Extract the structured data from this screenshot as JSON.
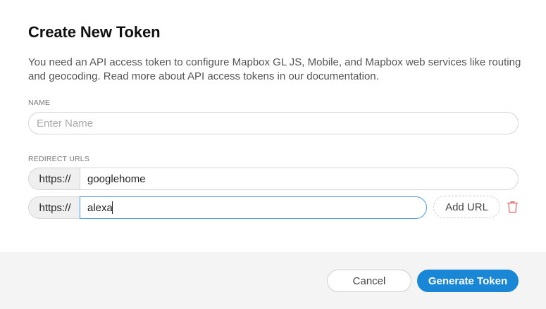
{
  "dialog": {
    "title": "Create New Token",
    "description": "You need an API access token to configure Mapbox GL JS, Mobile, and Mapbox web services like routing and geocoding. Read more about API access tokens in our documentation."
  },
  "name_field": {
    "label": "NAME",
    "placeholder": "Enter Name",
    "value": ""
  },
  "redirect_urls": {
    "label": "REDIRECT URLS",
    "rows": [
      {
        "prefix": "https://",
        "value": "googlehome"
      },
      {
        "prefix": "https://",
        "value": "alexa"
      }
    ],
    "add_label": "Add URL"
  },
  "icons": {
    "delete": "trash-icon"
  },
  "colors": {
    "primary": "#1a86d6",
    "focus_border": "#4a9de0",
    "delete_icon": "#e06b6b"
  },
  "actions": {
    "cancel_label": "Cancel",
    "generate_label": "Generate Token"
  }
}
